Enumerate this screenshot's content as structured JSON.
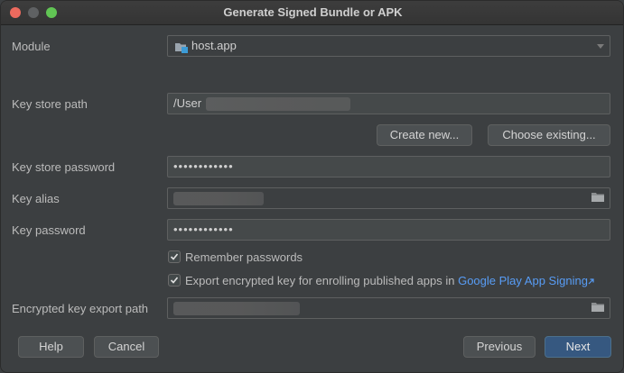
{
  "window": {
    "title": "Generate Signed Bundle or APK"
  },
  "module": {
    "label": "Module",
    "value": "host.app"
  },
  "keystore": {
    "path_label": "Key store path",
    "path_value": "/User",
    "create_label": "Create new...",
    "choose_label": "Choose existing...",
    "password_label": "Key store password",
    "password_value": "••••••••••••"
  },
  "key": {
    "alias_label": "Key alias",
    "password_label": "Key password",
    "password_value": "••••••••••••"
  },
  "options": {
    "remember_label": "Remember passwords",
    "remember_checked": true,
    "export_label": "Export encrypted key for enrolling published apps in",
    "export_link": "Google Play App Signing",
    "export_checked": true
  },
  "export_path": {
    "label": "Encrypted key export path"
  },
  "footer": {
    "help_label": "Help",
    "cancel_label": "Cancel",
    "previous_label": "Previous",
    "next_label": "Next"
  }
}
